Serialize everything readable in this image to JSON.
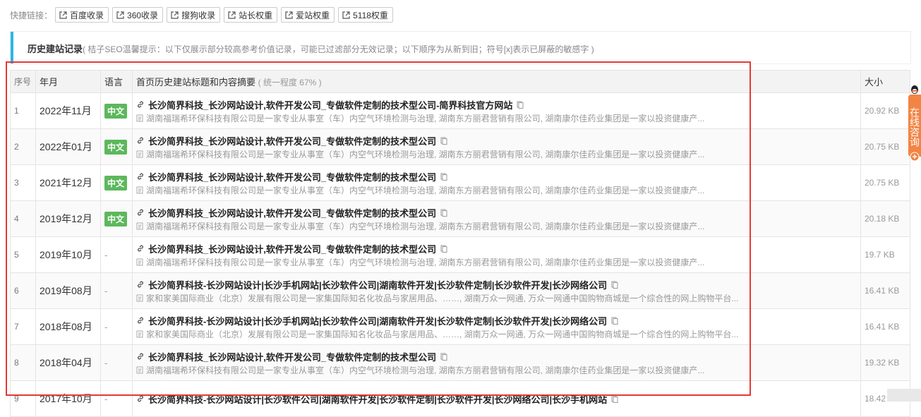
{
  "quicklinks": {
    "label": "快捷链接：",
    "items": [
      "百度收录",
      "360收录",
      "搜狗收录",
      "站长权重",
      "爱站权重",
      "5118权重"
    ]
  },
  "panel": {
    "title": "历史建站记录",
    "hint": "( 桔子SEO温馨提示：以下仅展示部分较高参考价值记录，可能已过滤部分无效记录；以下顺序为从新到旧；符号[x]表示已屏蔽的敏感字 )"
  },
  "table": {
    "headers": {
      "idx": "序号",
      "ym": "年月",
      "lang": "语言",
      "title": "首页历史建站标题和内容摘要",
      "title_sub": "( 统一程度 67% )",
      "size": "大小"
    },
    "rows": [
      {
        "idx": "1",
        "ym": "2022年11月",
        "lang": "中文",
        "title": "长沙简界科技_长沙网站设计,软件开发公司_专做软件定制的技术型公司-简界科技官方网站",
        "desc": "湖南福瑞希环保科技有限公司是一家专业从事室（车）内空气环境检测与治理, 湖南东方丽君营销有限公司, 湖南康尔佳药业集团是一家以投资健康产...",
        "size": "20.92 KB"
      },
      {
        "idx": "2",
        "ym": "2022年01月",
        "lang": "中文",
        "title": "长沙简界科技_长沙网站设计,软件开发公司_专做软件定制的技术型公司",
        "desc": "湖南福瑞希环保科技有限公司是一家专业从事室（车）内空气环境检测与治理, 湖南东方丽君营销有限公司, 湖南康尔佳药业集团是一家以投资健康产...",
        "size": "20.75 KB"
      },
      {
        "idx": "3",
        "ym": "2021年12月",
        "lang": "中文",
        "title": "长沙简界科技_长沙网站设计,软件开发公司_专做软件定制的技术型公司",
        "desc": "湖南福瑞希环保科技有限公司是一家专业从事室（车）内空气环境检测与治理, 湖南东方丽君营销有限公司, 湖南康尔佳药业集团是一家以投资健康产...",
        "size": "20.75 KB"
      },
      {
        "idx": "4",
        "ym": "2019年12月",
        "lang": "中文",
        "title": "长沙简界科技_长沙网站设计,软件开发公司_专做软件定制的技术型公司",
        "desc": "湖南福瑞希环保科技有限公司是一家专业从事室（车）内空气环境检测与治理, 湖南东方丽君营销有限公司, 湖南康尔佳药业集团是一家以投资健康产...",
        "size": "20.18 KB"
      },
      {
        "idx": "5",
        "ym": "2019年10月",
        "lang": "-",
        "title": "长沙简界科技_长沙网站设计,软件开发公司_专做软件定制的技术型公司",
        "desc": "湖南福瑞希环保科技有限公司是一家专业从事室（车）内空气环境检测与治理, 湖南东方丽君营销有限公司, 湖南康尔佳药业集团是一家以投资健康产...",
        "size": "19.7 KB"
      },
      {
        "idx": "6",
        "ym": "2019年08月",
        "lang": "-",
        "title": "长沙简界科技-长沙网站设计|长沙手机网站|长沙软件公司|湖南软件开发|长沙软件定制|长沙软件开发|长沙网络公司",
        "desc": "家和家美国际商业（北京）发展有限公司是一家集国际知名化妆品与家居用品、……, 湖南万众一网通, 万众一网通中国购物商城是一个综合性的网上购物平台...",
        "size": "16.41 KB"
      },
      {
        "idx": "7",
        "ym": "2018年08月",
        "lang": "-",
        "title": "长沙简界科技-长沙网站设计|长沙手机网站|长沙软件公司|湖南软件开发|长沙软件定制|长沙软件开发|长沙网络公司",
        "desc": "家和家美国际商业（北京）发展有限公司是一家集国际知名化妆品与家居用品、……, 湖南万众一网通, 万众一网通中国购物商城是一个综合性的网上购物平台...",
        "size": "16.41 KB"
      },
      {
        "idx": "8",
        "ym": "2018年04月",
        "lang": "-",
        "title": "长沙简界科技_长沙网站设计,软件开发公司_专做软件定制的技术型公司",
        "desc": "湖南福瑞希环保科技有限公司是一家专业从事室（车）内空气环境检测与治理, 湖南东方丽君营销有限公司, 湖南康尔佳药业集团是一家以投资健康产...",
        "size": "19.32 KB"
      },
      {
        "idx": "9",
        "ym": "2017年10月",
        "lang": "-",
        "title": "长沙简界科技-长沙网站设计|长沙软件公司|湖南软件开发|长沙软件定制|长沙软件开发|长沙网络公司|长沙手机网站",
        "desc": "",
        "size": "18.42 KB"
      }
    ]
  },
  "float_consult": {
    "label": "在线咨询"
  },
  "colors": {
    "accent": "#2cb7e6",
    "badge": "#5cb85c",
    "highlight": "#e53935",
    "consult": "#f28444"
  }
}
